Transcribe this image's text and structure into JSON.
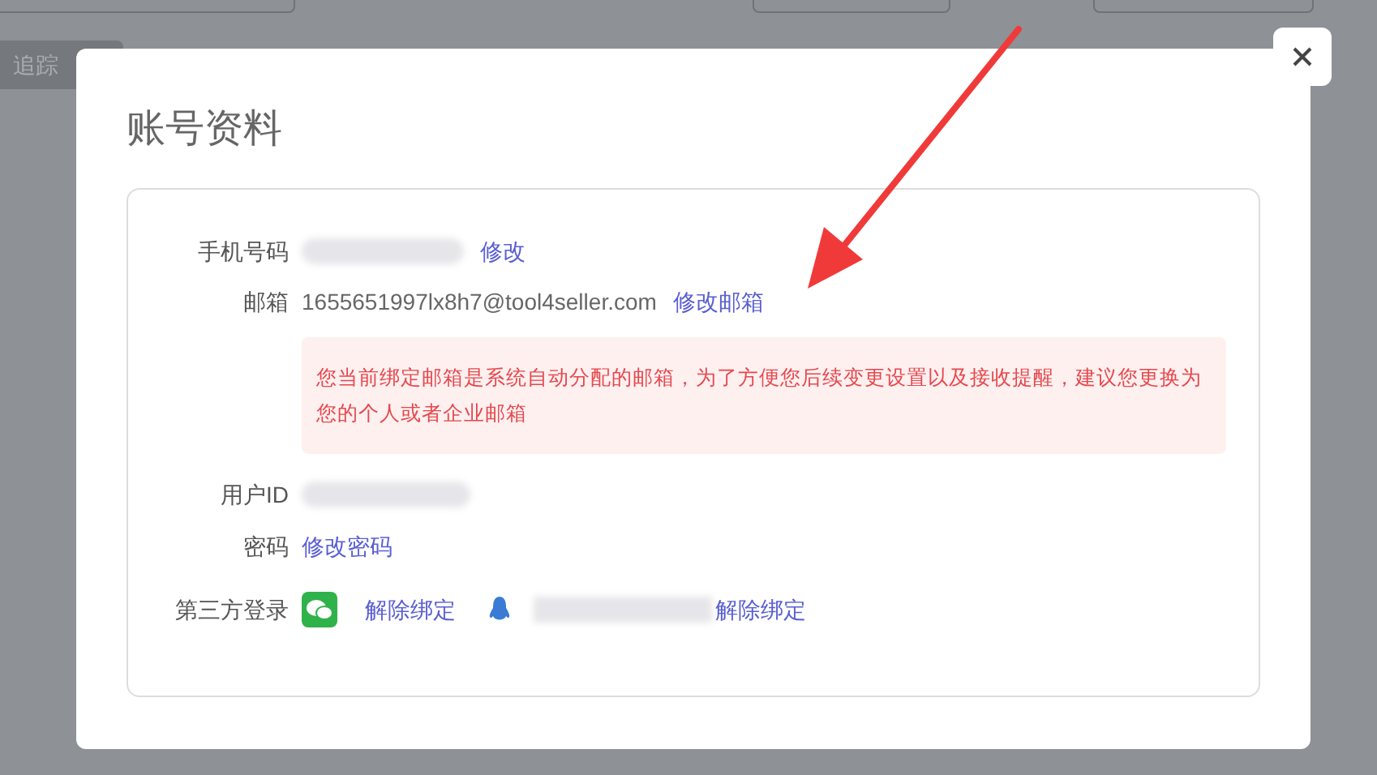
{
  "background": {
    "tab_label": "追踪"
  },
  "dialog": {
    "title": "账号资料",
    "rows": [
      {
        "kind": "phone",
        "label": "手机号码",
        "link": "修改"
      },
      {
        "kind": "email",
        "label": "邮箱",
        "value": "1655651997lx8h7@tool4seller.com",
        "link": "修改邮箱",
        "notice": "您当前绑定邮箱是系统自动分配的邮箱，为了方便您后续变更设置以及接收提醒，建议您更换为您的个人或者企业邮箱"
      },
      {
        "kind": "user_id",
        "label": "用户ID"
      },
      {
        "kind": "password",
        "label": "密码",
        "link": "修改密码"
      },
      {
        "kind": "third_party",
        "label": "第三方登录",
        "accounts": [
          {
            "kind": "wechat",
            "link": "解除绑定"
          },
          {
            "kind": "qq",
            "link": "解除绑定"
          }
        ]
      }
    ]
  }
}
